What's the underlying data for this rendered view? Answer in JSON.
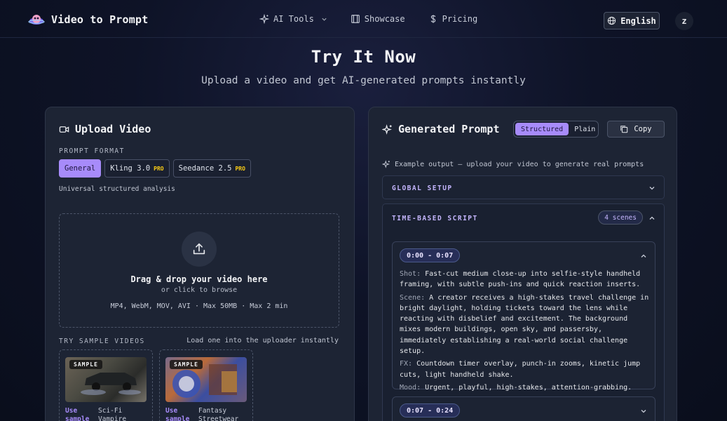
{
  "nav": {
    "brand": "Video to Prompt",
    "links": [
      {
        "label": "AI Tools",
        "icon": "sparkle-icon",
        "has_dropdown": true
      },
      {
        "label": "Showcase",
        "icon": "film-icon"
      },
      {
        "label": "Pricing",
        "icon": "dollar-icon"
      }
    ],
    "language": "English",
    "avatar_initial": "z"
  },
  "hero": {
    "title": "Try It Now",
    "subtitle": "Upload a video and get AI-generated prompts instantly"
  },
  "upload": {
    "title": "Upload Video",
    "format_label": "PROMPT FORMAT",
    "formats": [
      {
        "label": "General",
        "pro": "",
        "active": true
      },
      {
        "label": "Kling 3.0",
        "pro": "PRO",
        "active": false
      },
      {
        "label": "Seedance 2.5",
        "pro": "PRO",
        "active": false
      }
    ],
    "format_description": "Universal structured analysis",
    "dropzone": {
      "title": "Drag & drop your video here",
      "or": "or click to browse",
      "limits": "MP4, WebM, MOV, AVI · Max 50MB · Max 2 min"
    },
    "samples_label": "TRY SAMPLE VIDEOS",
    "samples_hint": "Load one into the uploader instantly",
    "samples": [
      {
        "badge": "SAMPLE",
        "use": "Use sample",
        "name": "Sci-Fi Vampire"
      },
      {
        "badge": "SAMPLE",
        "use": "Use sample",
        "name": "Fantasy Streetwear"
      }
    ]
  },
  "generated": {
    "title": "Generated Prompt",
    "modes": [
      "Structured",
      "Plain"
    ],
    "active_mode": "Structured",
    "copy_label": "Copy",
    "example_note": "Example output — upload your video to generate real prompts",
    "global_setup": "GLOBAL SETUP",
    "timeline_label": "TIME-BASED SCRIPT",
    "scene_count": "4 scenes",
    "scenes": [
      {
        "time": "0:00 - 0:07",
        "shot_key": "Shot:",
        "shot": "Fast-cut medium close-up into selfie-style handheld framing, with subtle push-ins and quick reaction inserts.",
        "scene_key": "Scene:",
        "scene": "A creator receives a high-stakes travel challenge in bright daylight, holding tickets toward the lens while reacting with disbelief and excitement. The background mixes modern buildings, open sky, and passersby, immediately establishing a real-world social challenge setup.",
        "fx_key": "FX:",
        "fx": "Countdown timer overlay, punch-in zooms, kinetic jump cuts, light handheld shake.",
        "mood_key": "Mood:",
        "mood": "Urgent, playful, high-stakes, attention-grabbing."
      },
      {
        "time": "0:07 - 0:24"
      }
    ]
  },
  "colors": {
    "accent": "#a78bfa",
    "pro_badge": "#facc15",
    "panel": "#1d2434",
    "background": "#0b1020"
  }
}
